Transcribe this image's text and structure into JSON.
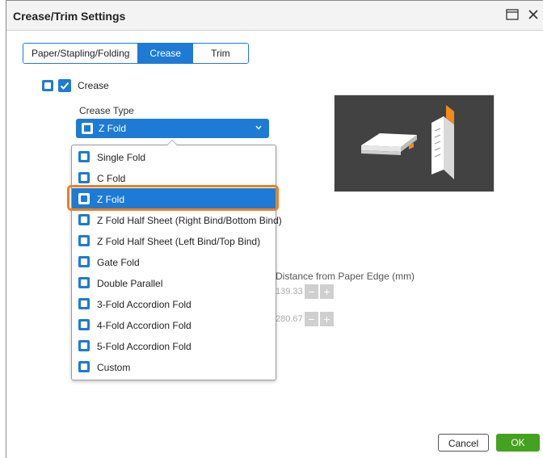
{
  "window": {
    "title": "Crease/Trim Settings"
  },
  "tabs": [
    {
      "label": "Paper/Stapling/Folding"
    },
    {
      "label": "Crease"
    },
    {
      "label": "Trim"
    }
  ],
  "crease": {
    "label": "Crease",
    "checked": true
  },
  "crease_type": {
    "label": "Crease Type",
    "selected": "Z Fold",
    "options": [
      {
        "label": "Single Fold"
      },
      {
        "label": "C Fold"
      },
      {
        "label": "Z Fold"
      },
      {
        "label": "Z Fold Half Sheet (Right Bind/Bottom Bind)"
      },
      {
        "label": "Z Fold Half Sheet (Left Bind/Top Bind)"
      },
      {
        "label": "Gate Fold"
      },
      {
        "label": "Double Parallel"
      },
      {
        "label": "3-Fold Accordion Fold"
      },
      {
        "label": "4-Fold Accordion Fold"
      },
      {
        "label": "5-Fold Accordion Fold"
      },
      {
        "label": "Custom"
      }
    ]
  },
  "distance": {
    "label": "Distance from Paper Edge (mm)",
    "values": [
      "139.33",
      "280.67"
    ],
    "minus": "−",
    "plus": "+"
  },
  "buttons": {
    "cancel": "Cancel",
    "ok": "OK"
  },
  "colors": {
    "accent": "#1d7bd6",
    "highlight": "#f07f1a",
    "ok": "#43a31e"
  }
}
